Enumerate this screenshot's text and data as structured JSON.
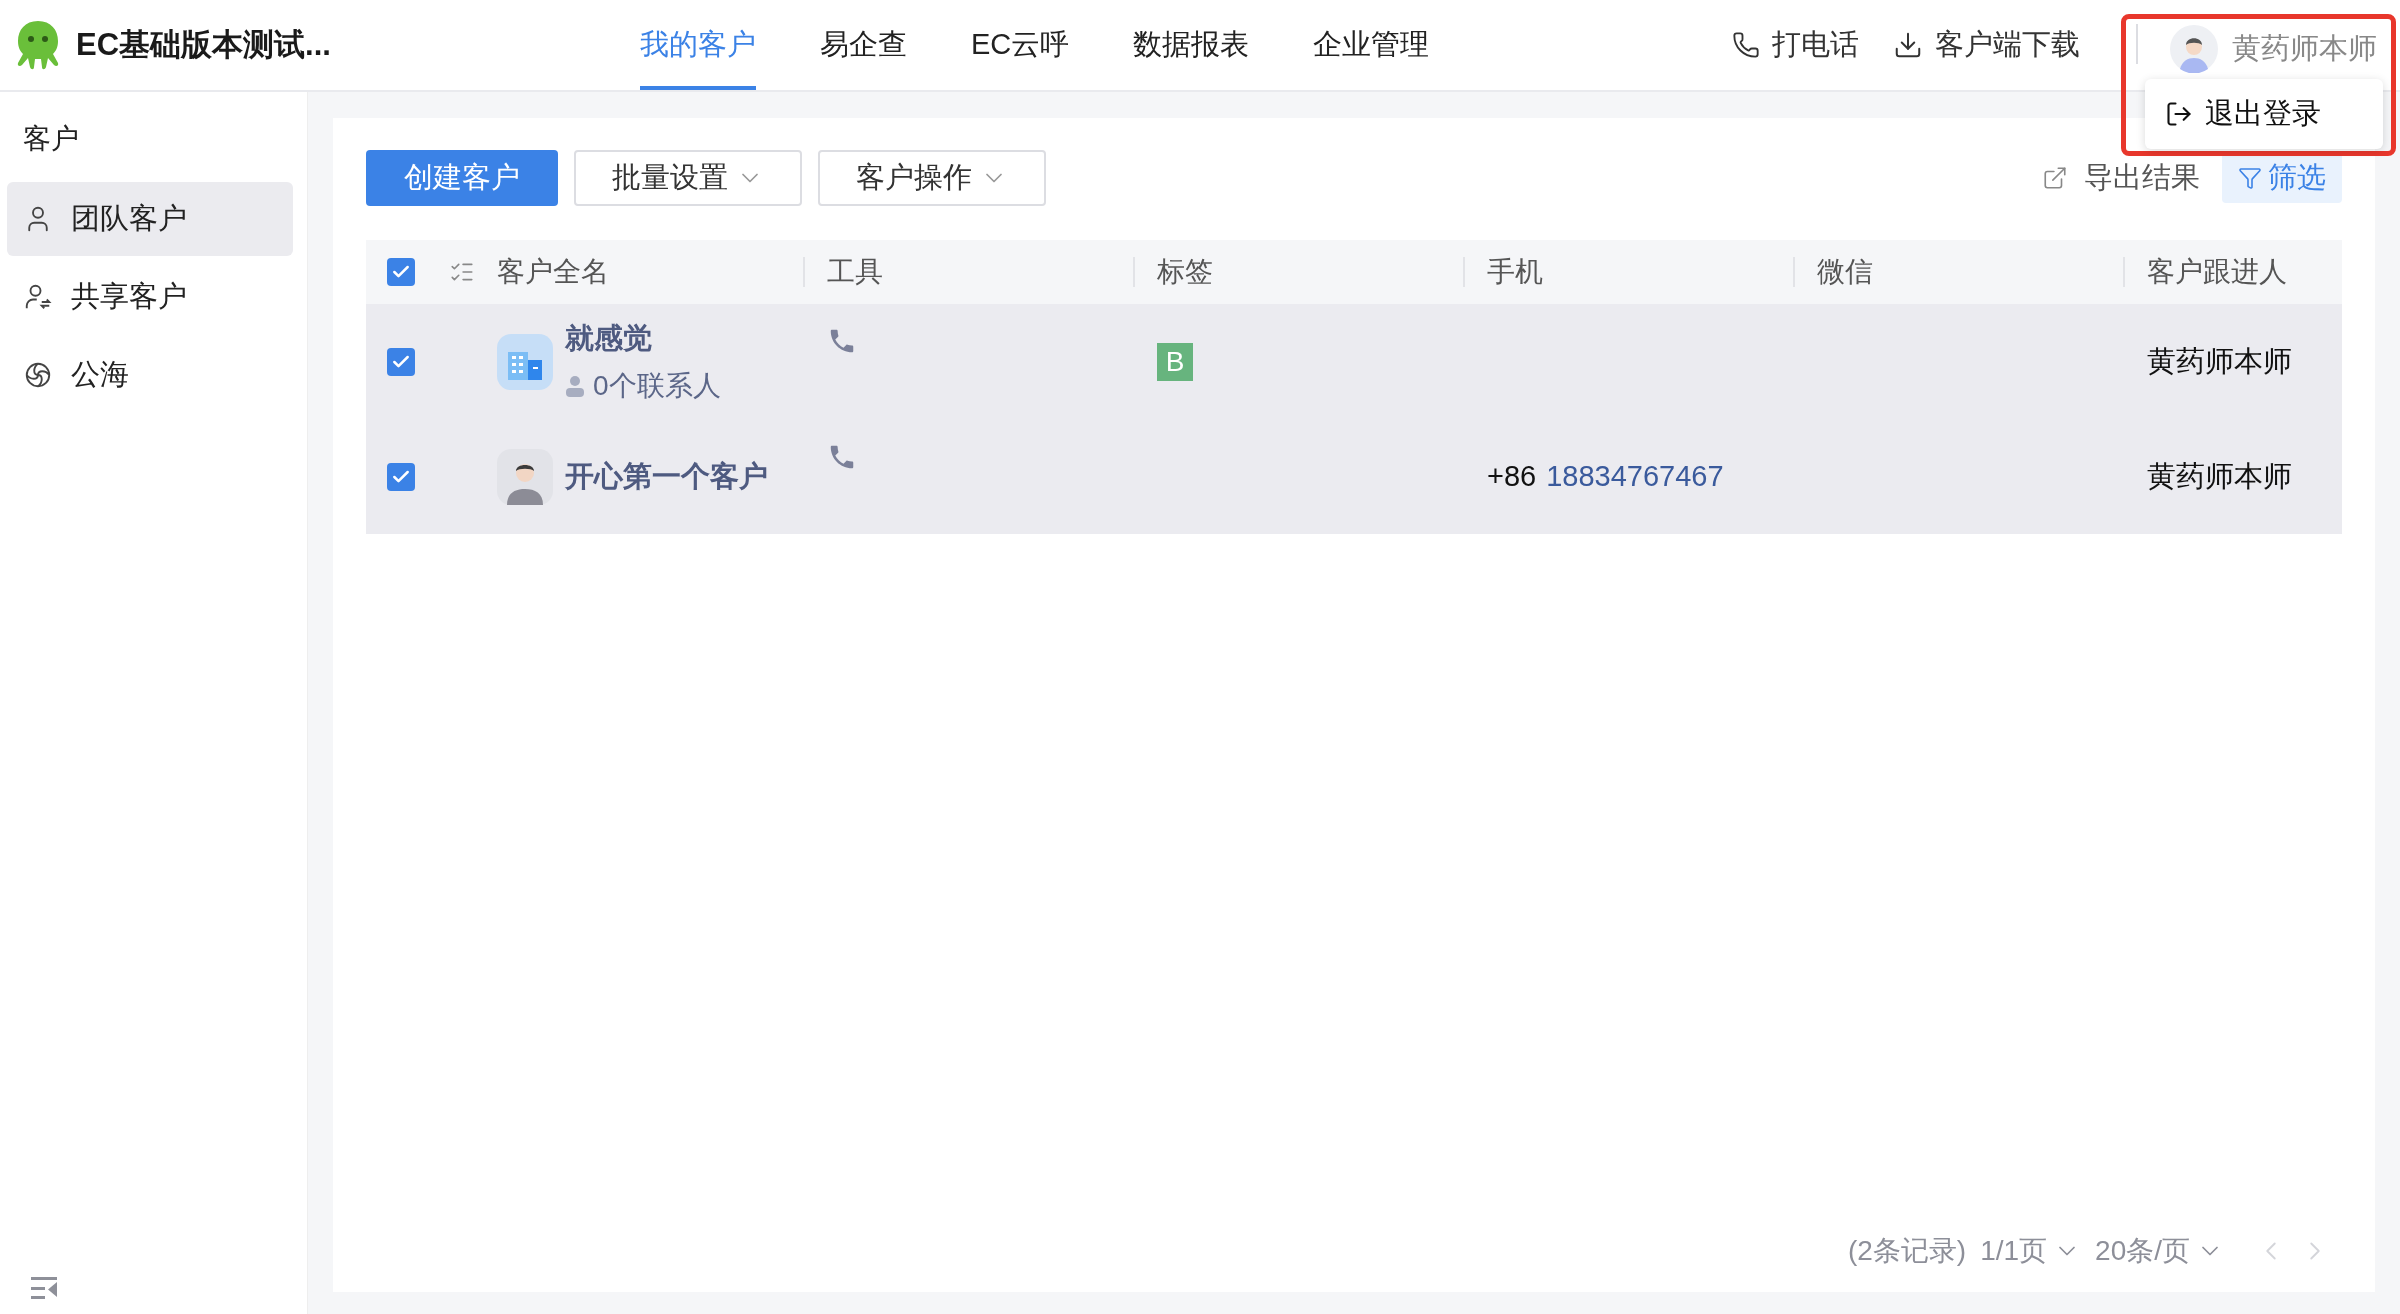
{
  "app": {
    "title": "EC基础版本测试..."
  },
  "nav": [
    {
      "label": "我的客户",
      "selected": true
    },
    {
      "label": "易企查",
      "selected": false
    },
    {
      "label": "EC云呼",
      "selected": false
    },
    {
      "label": "数据报表",
      "selected": false
    },
    {
      "label": "企业管理",
      "selected": false
    }
  ],
  "header_actions": [
    {
      "kind": "phone",
      "label": "打电话"
    },
    {
      "kind": "download",
      "label": "客户端下载"
    }
  ],
  "user": {
    "name": "黄药师本师"
  },
  "user_menu": [
    {
      "kind": "logout",
      "label": "退出登录"
    }
  ],
  "sidebar": {
    "title": "客户",
    "items": [
      {
        "kind": "person",
        "label": "团队客户",
        "selected": true
      },
      {
        "kind": "shared",
        "label": "共享客户",
        "selected": false
      },
      {
        "kind": "sea",
        "label": "公海",
        "selected": false
      }
    ]
  },
  "toolbar": {
    "buttons": [
      {
        "kind": "primary",
        "label": "创建客户"
      },
      {
        "kind": "dropdown",
        "label": "批量设置"
      },
      {
        "kind": "dropdown",
        "label": "客户操作"
      }
    ],
    "export": "导出结果",
    "filter": {
      "label": "筛选",
      "active": true
    }
  },
  "table": {
    "all_checked": true,
    "columns": [
      "客户全名",
      "工具",
      "标签",
      "手机",
      "微信",
      "客户跟进人"
    ],
    "rows": [
      {
        "checked": true,
        "avatar": {
          "kind": "company"
        },
        "name": "就感觉",
        "contacts": "0个联系人",
        "tools": [
          {
            "kind": "phone"
          }
        ],
        "tags": [
          {
            "label": "B",
            "color": "#67b47e"
          }
        ],
        "follower": "黄药师本师"
      },
      {
        "checked": true,
        "avatar": {
          "kind": "person"
        },
        "name": "开心第一个客户",
        "tools": [
          {
            "kind": "phone"
          }
        ],
        "phone_prefix": "+86",
        "phone": "18834767467",
        "follower": "黄药师本师"
      }
    ]
  },
  "pagination": {
    "records": "(2条记录)",
    "page": "1/1页",
    "page_size": "20条/页"
  }
}
